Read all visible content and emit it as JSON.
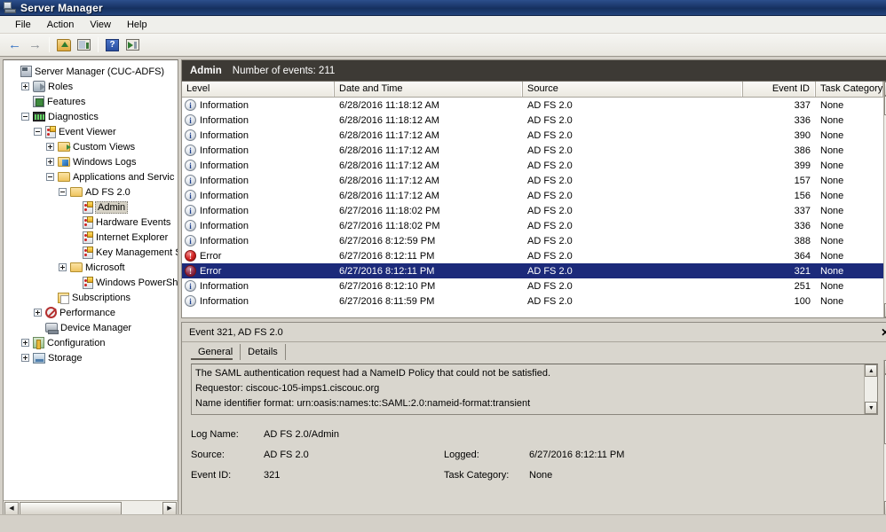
{
  "window": {
    "title": "Server Manager",
    "icon": "server-manager-icon"
  },
  "menubar": {
    "items": [
      "File",
      "Action",
      "View",
      "Help"
    ]
  },
  "toolbar": {
    "buttons": [
      {
        "name": "back-button",
        "icon": "left-arrow-icon",
        "glyph": "←"
      },
      {
        "name": "forward-button",
        "icon": "right-arrow-icon",
        "glyph": "→"
      },
      {
        "name": "up-one-level-button",
        "icon": "folder-up-icon"
      },
      {
        "name": "show-hide-console-tree-button",
        "icon": "console-tree-icon"
      },
      {
        "name": "help-button",
        "icon": "help-question-icon",
        "glyph": "?"
      },
      {
        "name": "show-hide-action-pane-button",
        "icon": "action-pane-icon"
      }
    ]
  },
  "tree": {
    "nodes": [
      {
        "label": "Server Manager (CUC-ADFS)",
        "indent": 0,
        "expander": "none",
        "icon": "server-icon",
        "selected": false
      },
      {
        "label": "Roles",
        "indent": 1,
        "expander": "plus",
        "icon": "roles-icon",
        "selected": false
      },
      {
        "label": "Features",
        "indent": 1,
        "expander": "none",
        "icon": "features-icon",
        "selected": false
      },
      {
        "label": "Diagnostics",
        "indent": 1,
        "expander": "minus",
        "icon": "diagnostics-icon",
        "selected": false
      },
      {
        "label": "Event Viewer",
        "indent": 2,
        "expander": "minus",
        "icon": "event-viewer-icon",
        "selected": false
      },
      {
        "label": "Custom Views",
        "indent": 3,
        "expander": "plus",
        "icon": "custom-views-folder-icon",
        "selected": false
      },
      {
        "label": "Windows Logs",
        "indent": 3,
        "expander": "plus",
        "icon": "windows-logs-folder-icon",
        "selected": false
      },
      {
        "label": "Applications and Servic",
        "indent": 3,
        "expander": "minus",
        "icon": "folder-icon",
        "selected": false
      },
      {
        "label": "AD FS 2.0",
        "indent": 4,
        "expander": "minus",
        "icon": "folder-icon",
        "selected": false
      },
      {
        "label": "Admin",
        "indent": 5,
        "expander": "none",
        "icon": "event-log-icon",
        "selected": true
      },
      {
        "label": "Hardware Events",
        "indent": 5,
        "expander": "none",
        "icon": "event-log-icon",
        "selected": false
      },
      {
        "label": "Internet Explorer",
        "indent": 5,
        "expander": "none",
        "icon": "event-log-icon",
        "selected": false
      },
      {
        "label": "Key Management S",
        "indent": 5,
        "expander": "none",
        "icon": "event-log-icon",
        "selected": false
      },
      {
        "label": "Microsoft",
        "indent": 4,
        "expander": "plus",
        "icon": "folder-icon",
        "selected": false
      },
      {
        "label": "Windows PowerShe",
        "indent": 5,
        "expander": "none",
        "icon": "event-log-icon",
        "selected": false
      },
      {
        "label": "Subscriptions",
        "indent": 3,
        "expander": "none",
        "icon": "subscriptions-icon",
        "selected": false
      },
      {
        "label": "Performance",
        "indent": 2,
        "expander": "plus",
        "icon": "performance-icon",
        "selected": false
      },
      {
        "label": "Device Manager",
        "indent": 2,
        "expander": "none",
        "icon": "device-manager-icon",
        "selected": false
      },
      {
        "label": "Configuration",
        "indent": 1,
        "expander": "plus",
        "icon": "configuration-icon",
        "selected": false
      },
      {
        "label": "Storage",
        "indent": 1,
        "expander": "plus",
        "icon": "storage-icon",
        "selected": false
      }
    ]
  },
  "eventlist": {
    "header": {
      "name": "Admin",
      "count_label": "Number of events: 211"
    },
    "columns": [
      "Level",
      "Date and Time",
      "Source",
      "Event ID",
      "Task Category"
    ],
    "rows": [
      {
        "level": "Information",
        "severity": "info",
        "date": "6/28/2016 11:18:12 AM",
        "source": "AD FS 2.0",
        "event_id": "337",
        "task": "None",
        "selected": false
      },
      {
        "level": "Information",
        "severity": "info",
        "date": "6/28/2016 11:18:12 AM",
        "source": "AD FS 2.0",
        "event_id": "336",
        "task": "None",
        "selected": false
      },
      {
        "level": "Information",
        "severity": "info",
        "date": "6/28/2016 11:17:12 AM",
        "source": "AD FS 2.0",
        "event_id": "390",
        "task": "None",
        "selected": false
      },
      {
        "level": "Information",
        "severity": "info",
        "date": "6/28/2016 11:17:12 AM",
        "source": "AD FS 2.0",
        "event_id": "386",
        "task": "None",
        "selected": false
      },
      {
        "level": "Information",
        "severity": "info",
        "date": "6/28/2016 11:17:12 AM",
        "source": "AD FS 2.0",
        "event_id": "399",
        "task": "None",
        "selected": false
      },
      {
        "level": "Information",
        "severity": "info",
        "date": "6/28/2016 11:17:12 AM",
        "source": "AD FS 2.0",
        "event_id": "157",
        "task": "None",
        "selected": false
      },
      {
        "level": "Information",
        "severity": "info",
        "date": "6/28/2016 11:17:12 AM",
        "source": "AD FS 2.0",
        "event_id": "156",
        "task": "None",
        "selected": false
      },
      {
        "level": "Information",
        "severity": "info",
        "date": "6/27/2016 11:18:02 PM",
        "source": "AD FS 2.0",
        "event_id": "337",
        "task": "None",
        "selected": false
      },
      {
        "level": "Information",
        "severity": "info",
        "date": "6/27/2016 11:18:02 PM",
        "source": "AD FS 2.0",
        "event_id": "336",
        "task": "None",
        "selected": false
      },
      {
        "level": "Information",
        "severity": "info",
        "date": "6/27/2016 8:12:59 PM",
        "source": "AD FS 2.0",
        "event_id": "388",
        "task": "None",
        "selected": false
      },
      {
        "level": "Error",
        "severity": "error",
        "date": "6/27/2016 8:12:11 PM",
        "source": "AD FS 2.0",
        "event_id": "364",
        "task": "None",
        "selected": false
      },
      {
        "level": "Error",
        "severity": "error",
        "date": "6/27/2016 8:12:11 PM",
        "source": "AD FS 2.0",
        "event_id": "321",
        "task": "None",
        "selected": true
      },
      {
        "level": "Information",
        "severity": "info",
        "date": "6/27/2016 8:12:10 PM",
        "source": "AD FS 2.0",
        "event_id": "251",
        "task": "None",
        "selected": false
      },
      {
        "level": "Information",
        "severity": "info",
        "date": "6/27/2016 8:11:59 PM",
        "source": "AD FS 2.0",
        "event_id": "100",
        "task": "None",
        "selected": false
      }
    ]
  },
  "detail": {
    "title": "Event 321, AD FS 2.0",
    "close_label": "✕",
    "tabs": [
      {
        "label": "General",
        "active": true
      },
      {
        "label": "Details",
        "active": false
      }
    ],
    "message_lines": [
      "The SAML authentication request had a NameID Policy that could not be satisfied.",
      "Requestor: ciscouc-105-imps1.ciscouc.org",
      "Name identifier format: urn:oasis:names:tc:SAML:2.0:nameid-format:transient"
    ],
    "fields": {
      "log_name_label": "Log Name:",
      "log_name_value": "AD FS 2.0/Admin",
      "source_label": "Source:",
      "source_value": "AD FS 2.0",
      "logged_label": "Logged:",
      "logged_value": "6/27/2016 8:12:11 PM",
      "event_id_label": "Event ID:",
      "event_id_value": "321",
      "task_category_label": "Task Category:",
      "task_category_value": "None"
    }
  },
  "scroll": {
    "up_glyph": "▲",
    "down_glyph": "▼",
    "left_glyph": "◀",
    "right_glyph": "▶"
  },
  "colors": {
    "titlebar": "#1a3669",
    "selection": "#1c2a7a",
    "header_bar": "#3d3a35",
    "chrome": "#d4d0c8",
    "error": "#d02020"
  }
}
